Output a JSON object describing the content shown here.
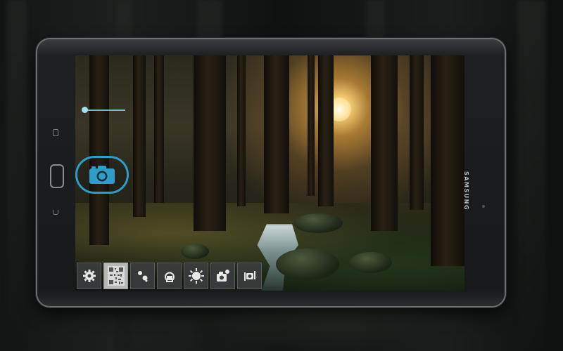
{
  "device": {
    "brand": "SAMSUNG"
  },
  "camera": {
    "zoom_level": 0.0,
    "shutter_icon": "camera-icon",
    "accent_color": "#2c9ec8"
  },
  "toolbar": {
    "items": [
      {
        "name": "settings",
        "icon": "gear-icon"
      },
      {
        "name": "qr-scanner",
        "icon": "qr-code-icon"
      },
      {
        "name": "color-effect",
        "icon": "dots-icon"
      },
      {
        "name": "white-balance",
        "icon": "bulb-icon"
      },
      {
        "name": "exposure",
        "icon": "sun-icon"
      },
      {
        "name": "scene-mode",
        "icon": "camera-scene-icon"
      },
      {
        "name": "switch-camera",
        "icon": "switch-camera-icon"
      }
    ]
  }
}
